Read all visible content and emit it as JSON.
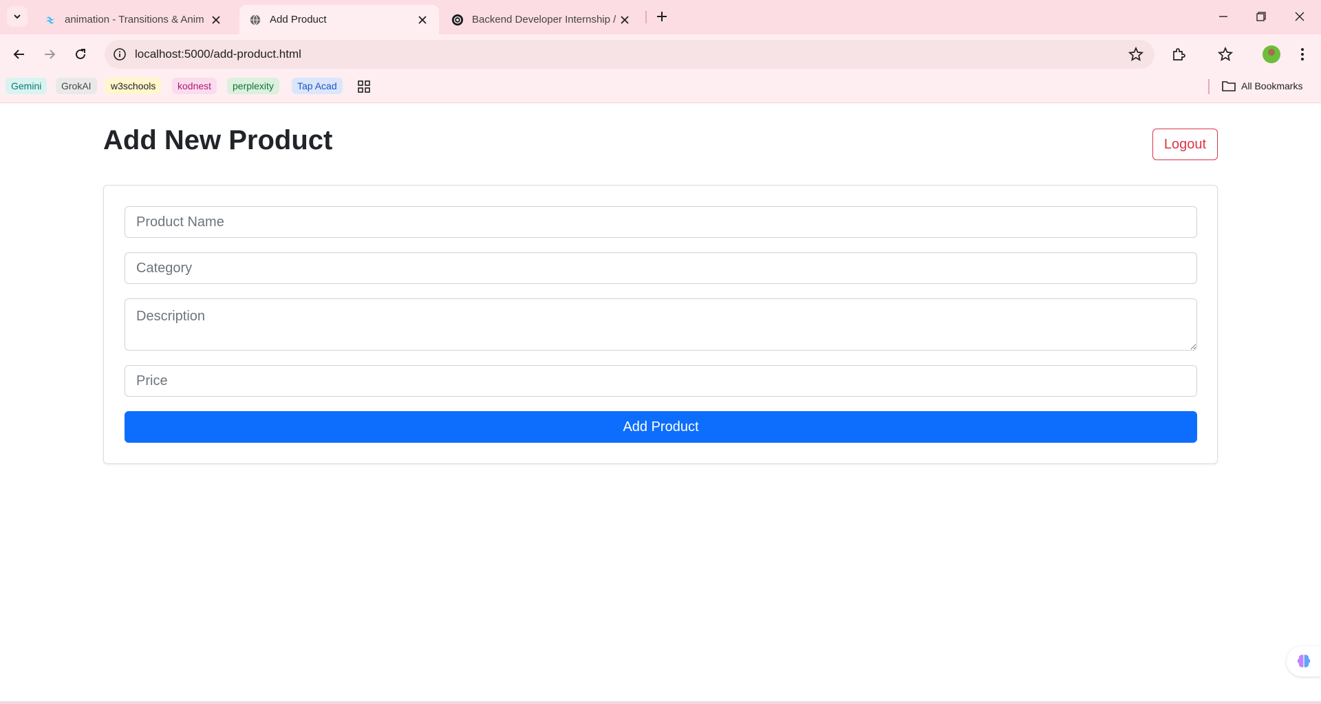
{
  "browser": {
    "tabs": [
      {
        "title": "animation - Transitions & Anim",
        "active": false,
        "favicon": "tailwind-icon"
      },
      {
        "title": "Add Product",
        "active": true,
        "favicon": "globe-icon"
      },
      {
        "title": "Backend Developer Internship /",
        "active": false,
        "favicon": "openai-icon"
      }
    ],
    "url": "localhost:5000/add-product.html",
    "bookmarks": [
      {
        "label": "Gemini",
        "color": "#0b7a75",
        "bg": "#d9f3f1"
      },
      {
        "label": "GrokAI",
        "color": "#444746",
        "bg": "#e9e9ea"
      },
      {
        "label": "w3schools",
        "color": "#1f1f1f",
        "bg": "#fff6cc"
      },
      {
        "label": "kodnest",
        "color": "#b3186f",
        "bg": "#fbdcef"
      },
      {
        "label": "perplexity",
        "color": "#137333",
        "bg": "#dbf0df"
      },
      {
        "label": "Tap Acad",
        "color": "#1a56c4",
        "bg": "#dbe6fb"
      }
    ],
    "all_bookmarks_label": "All Bookmarks"
  },
  "page": {
    "title": "Add New Product",
    "logout_label": "Logout",
    "form": {
      "product_name_placeholder": "Product Name",
      "category_placeholder": "Category",
      "description_placeholder": "Description",
      "price_placeholder": "Price",
      "submit_label": "Add Product"
    }
  },
  "colors": {
    "primary": "#0d6efd",
    "danger": "#dc3545",
    "chrome_bg": "#fcdde3"
  }
}
